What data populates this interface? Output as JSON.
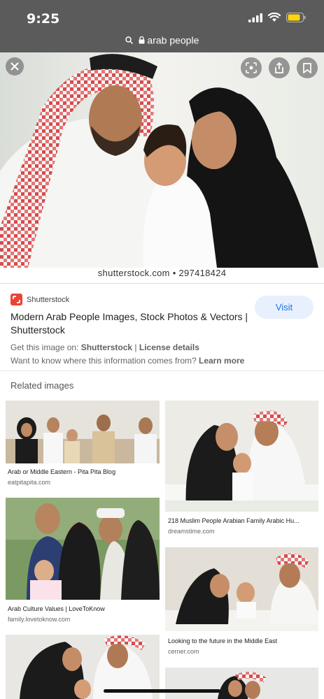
{
  "status": {
    "time": "9:25"
  },
  "address_bar": {
    "url": "arab people"
  },
  "viewer": {
    "watermark": "shutterstock.com • 297418424",
    "icons": [
      "close-icon",
      "lens-icon",
      "share-icon",
      "bookmark-icon"
    ]
  },
  "result": {
    "source": "Shutterstock",
    "title": "Modern Arab People Images, Stock Photos & Vectors | Shutterstock",
    "visit_label": "Visit",
    "get_prefix": "Get this image on: ",
    "get_source": "Shutterstock",
    "get_separator": " | ",
    "license_label": "License details",
    "info_prefix": "Want to know where this information comes from? ",
    "learn_more": "Learn more"
  },
  "related": {
    "heading": "Related images",
    "items": [
      {
        "title": "Arab or Middle Eastern - Pita Pita Blog",
        "domain": "eatpitapita.com"
      },
      {
        "title": "218 Muslim People Arabian Family Arabic Hu...",
        "domain": "dreamstime.com"
      },
      {
        "title": "Arab Culture Values | LoveToKnow",
        "domain": "family.lovetoknow.com"
      },
      {
        "title": "Looking to the future in the Middle East",
        "domain": "cerner.com"
      }
    ]
  },
  "colors": {
    "status_bar": "#5b5b5b",
    "accent": "#1a73e8",
    "visit_bg": "#e8f0fe",
    "logo": "#ea4335"
  }
}
